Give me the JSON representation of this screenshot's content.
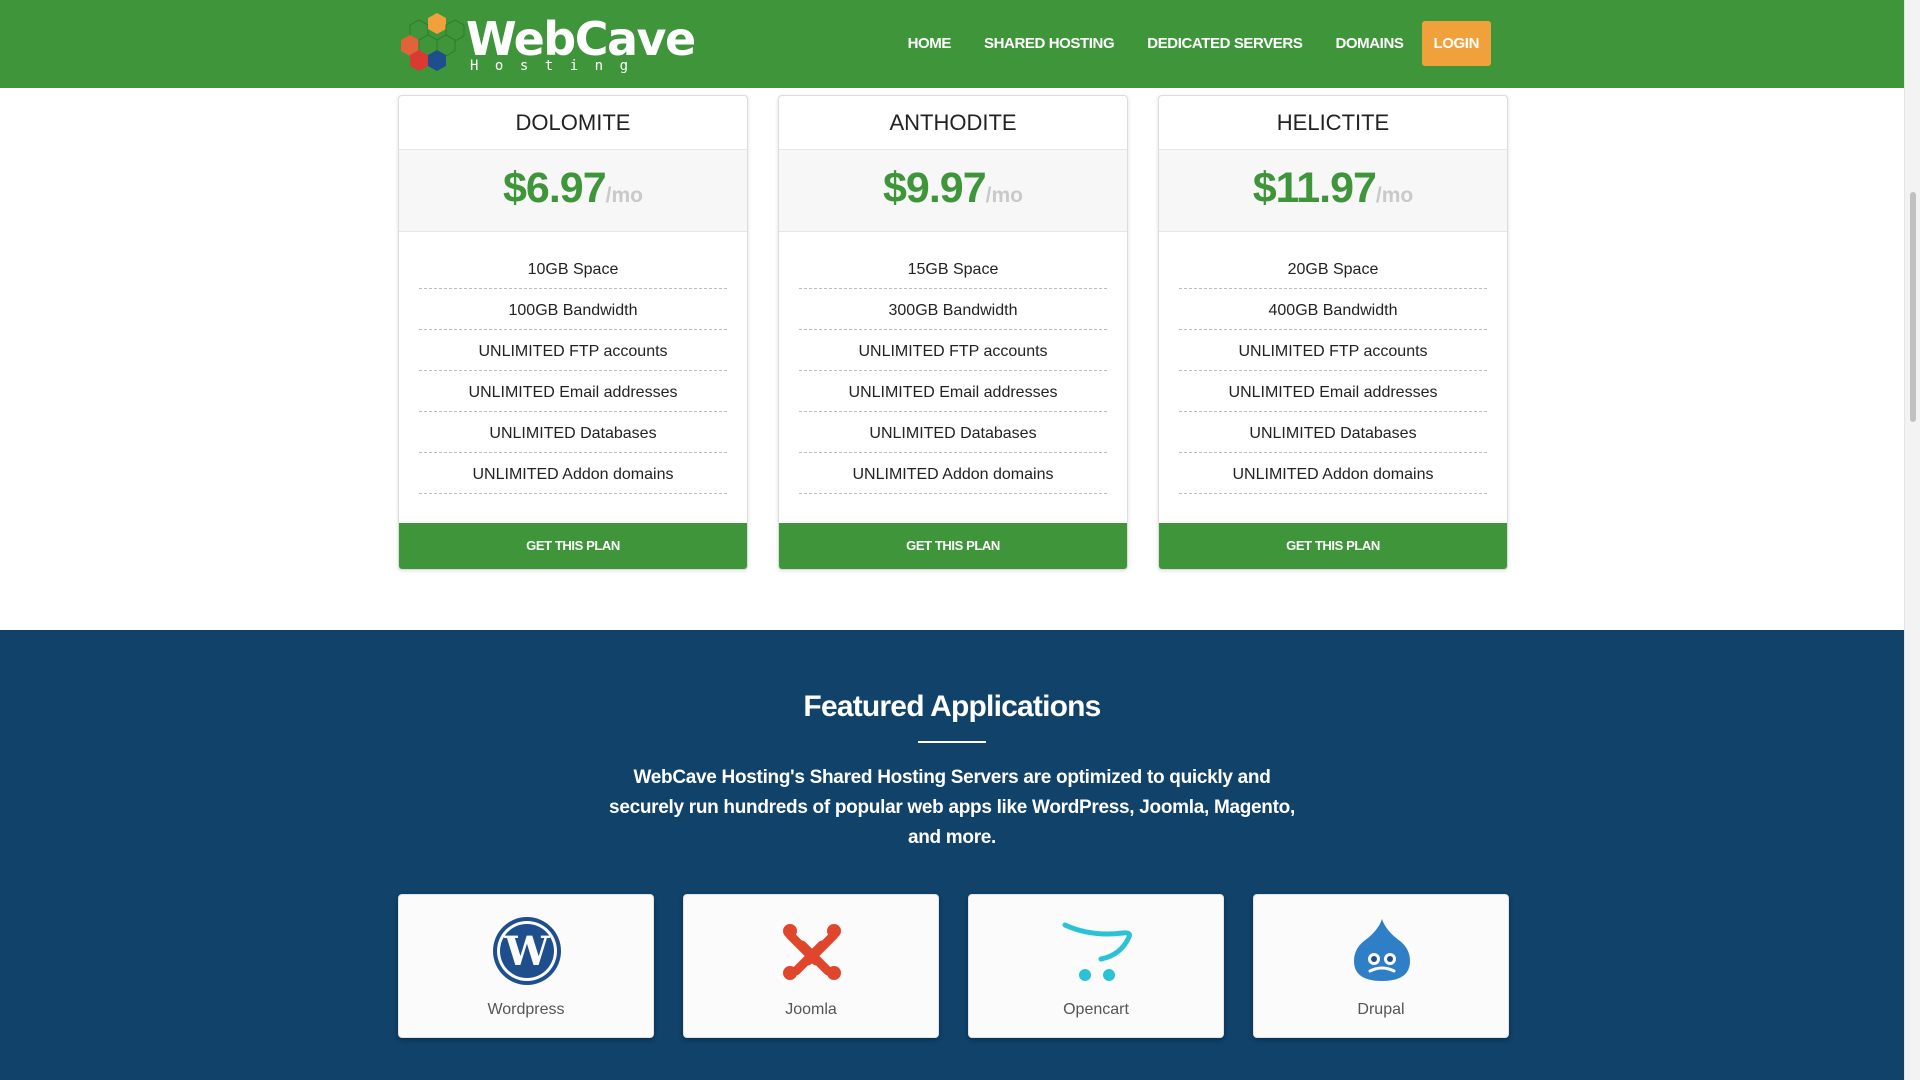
{
  "brand": {
    "name": "WebCave",
    "tagline": "Hosting",
    "colors": {
      "primary_green": "#3f963a",
      "accent_orange": "#f0a13b",
      "navy": "#10426a"
    }
  },
  "nav": {
    "items": [
      "HOME",
      "SHARED HOSTING",
      "DEDICATED SERVERS",
      "DOMAINS"
    ],
    "login": "LOGIN"
  },
  "plans": [
    {
      "name": "DOLOMITE",
      "price": "$6.97",
      "per": "/mo",
      "features": [
        "10GB Space",
        "100GB Bandwidth",
        "UNLIMITED FTP accounts",
        "UNLIMITED Email addresses",
        "UNLIMITED Databases",
        "UNLIMITED Addon domains"
      ],
      "cta": "GET THIS PLAN"
    },
    {
      "name": "ANTHODITE",
      "price": "$9.97",
      "per": "/mo",
      "features": [
        "15GB Space",
        "300GB Bandwidth",
        "UNLIMITED FTP accounts",
        "UNLIMITED Email addresses",
        "UNLIMITED Databases",
        "UNLIMITED Addon domains"
      ],
      "cta": "GET THIS PLAN"
    },
    {
      "name": "HELICTITE",
      "price": "$11.97",
      "per": "/mo",
      "features": [
        "20GB Space",
        "400GB Bandwidth",
        "UNLIMITED FTP accounts",
        "UNLIMITED Email addresses",
        "UNLIMITED Databases",
        "UNLIMITED Addon domains"
      ],
      "cta": "GET THIS PLAN"
    }
  ],
  "featured": {
    "title": "Featured Applications",
    "description": "WebCave Hosting's Shared Hosting Servers are optimized to quickly and securely run hundreds of popular web apps like WordPress, Joomla, Magento, and more.",
    "apps": [
      {
        "label": "Wordpress",
        "icon": "wordpress-icon"
      },
      {
        "label": "Joomla",
        "icon": "joomla-icon"
      },
      {
        "label": "Opencart",
        "icon": "opencart-icon"
      },
      {
        "label": "Drupal",
        "icon": "drupal-icon"
      }
    ]
  }
}
